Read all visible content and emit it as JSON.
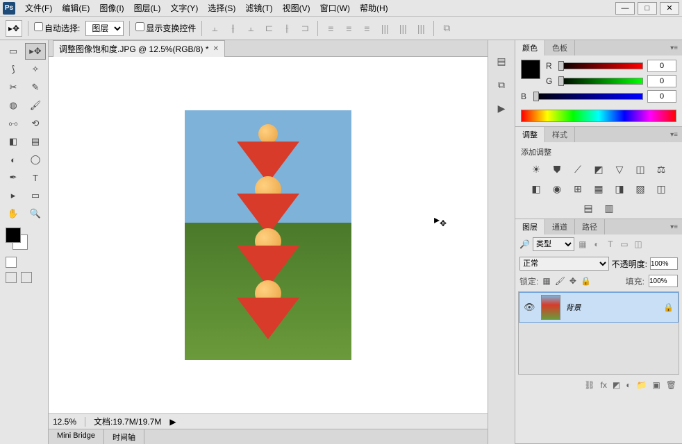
{
  "menu": {
    "file": "文件(F)",
    "edit": "编辑(E)",
    "image": "图像(I)",
    "layer": "图层(L)",
    "type": "文字(Y)",
    "select": "选择(S)",
    "filter": "滤镜(T)",
    "view": "视图(V)",
    "window": "窗口(W)",
    "help": "帮助(H)"
  },
  "options": {
    "auto_select": "自动选择:",
    "auto_select_target": "图层",
    "show_transform": "显示变换控件"
  },
  "doctab": {
    "title": "调整图像饱和度.JPG @ 12.5%(RGB/8) *"
  },
  "status": {
    "zoom": "12.5%",
    "doc_label": "文档:",
    "doc_size": "19.7M/19.7M"
  },
  "bottom_tabs": {
    "mini_bridge": "Mini Bridge",
    "timeline": "时间轴"
  },
  "panels": {
    "color": {
      "tab_color": "颜色",
      "tab_swatch": "色板",
      "r_label": "R",
      "g_label": "G",
      "b_label": "B",
      "r_val": "0",
      "g_val": "0",
      "b_val": "0"
    },
    "adjust": {
      "tab_adjust": "调整",
      "tab_style": "样式",
      "title": "添加调整"
    },
    "layers": {
      "tab_layers": "图层",
      "tab_channels": "通道",
      "tab_paths": "路径",
      "kind_label": "类型",
      "blend_mode": "正常",
      "opacity_label": "不透明度:",
      "opacity_val": "100%",
      "lock_label": "锁定:",
      "fill_label": "填充:",
      "fill_val": "100%",
      "layer_name": "背景"
    }
  }
}
